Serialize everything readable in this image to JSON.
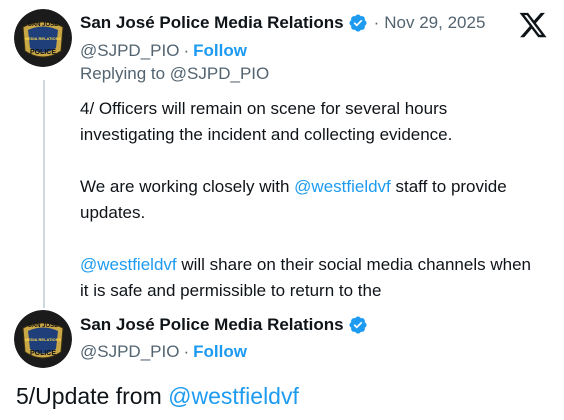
{
  "post1": {
    "author_name": "San José Police Media Relations",
    "handle": "@SJPD_PIO",
    "handle_separator": "·",
    "follow_label": "Follow",
    "date_separator": "·",
    "date": "Nov 29, 2025",
    "replying_to": "Replying to @SJPD_PIO",
    "paragraph1": "4/ Officers will remain on scene for several hours investigating the incident and collecting evidence.",
    "paragraph2_pre": "We are working closely with ",
    "paragraph2_mention": "@westfieldvf",
    "paragraph2_post": " staff to provide updates.",
    "paragraph3_mention": "@westfieldvf",
    "paragraph3_post": " will share on their social media channels when it is safe and permissible to return to the"
  },
  "post2": {
    "author_name": "San José Police Media Relations",
    "handle": "@SJPD_PIO",
    "handle_separator": "·",
    "follow_label": "Follow",
    "text_pre": "5/Update from ",
    "text_mention": "@westfieldvf"
  },
  "avatar_text": {
    "top": "SAN JOSE",
    "middle": "MEDIA RELATIONS",
    "bottom": "POLICE"
  },
  "icons": {
    "verified": "verified-badge-icon",
    "platform_logo": "x-logo-icon"
  },
  "colors": {
    "link": "#1d9bf0",
    "secondary_text": "#536471",
    "primary_text": "#0f1419",
    "thread_line": "#cfd9de"
  }
}
